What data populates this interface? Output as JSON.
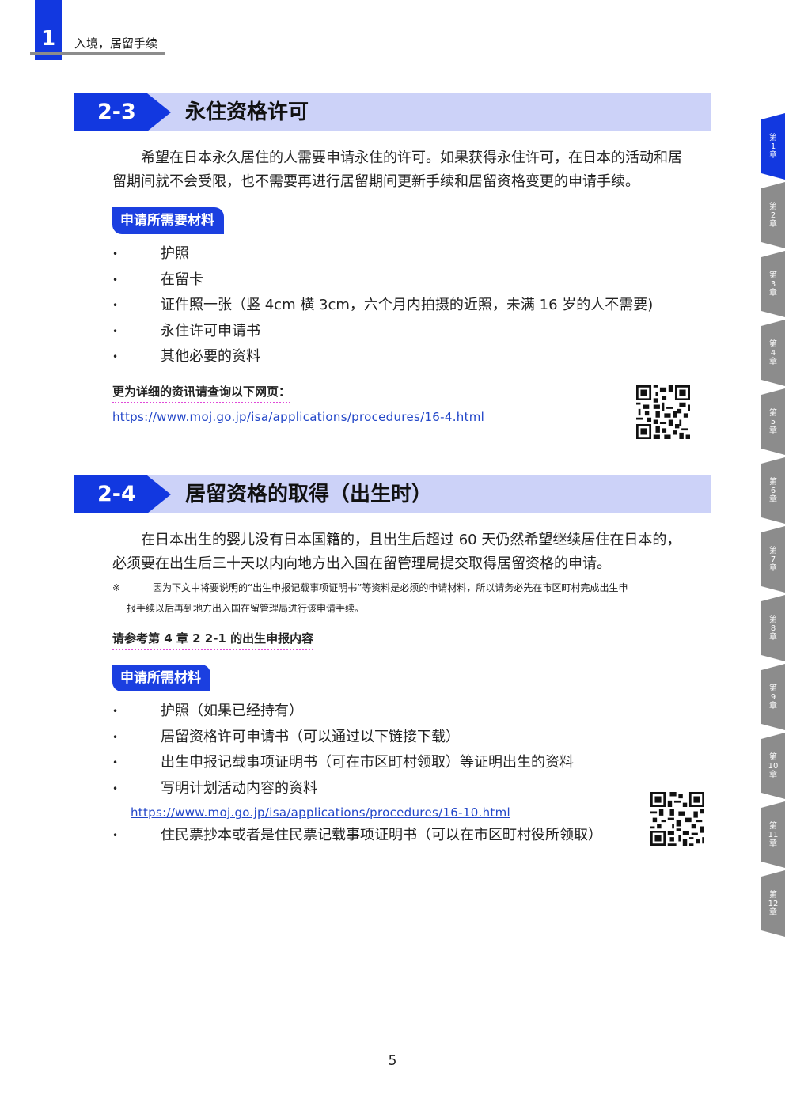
{
  "header": {
    "chapter_number": "1",
    "chapter_title": "入境，居留手续"
  },
  "section_2_3": {
    "number": "2-3",
    "title": "永住资格许可",
    "paragraph_line1": "希望在日本永久居住的人需要申请永住的许可。如果获得永住许可，在日本的活动和居",
    "paragraph_line2": "留期间就不会受限，也不需要再进行居留期间更新手续和居留资格变更的申请手续。",
    "materials_tag": "申请所需要材料",
    "materials": [
      "护照",
      "在留卡",
      "证件照一张（竖 4cm 横 3cm，六个月内拍摄的近照，未满 16 岁的人不需要)",
      "永住许可申请书",
      "其他必要的资料"
    ],
    "more_info_label": "更为详细的资讯请查询以下网页：",
    "link": "https://www.moj.go.jp/isa/applications/procedures/16-4.html"
  },
  "section_2_4": {
    "number": "2-4",
    "title": "居留资格的取得（出生时）",
    "paragraph_line1": "在日本出生的婴儿没有日本国籍的，且出生后超过 60 天仍然希望继续居住在日本的，",
    "paragraph_line2": "必须要在出生后三十天以内向地方出入国在留管理局提交取得居留资格的申请。",
    "note_mark": "※",
    "note_line1": "因为下文中将要说明的“出生申报记载事项证明书”等资料是必须的申请材料，所以请务必先在市区町村完成出生申",
    "note_line2": "报手续以后再到地方出入国在留管理局进行该申请手续。",
    "reference_label": "请参考第 4 章 2 2-1 的出生申报内容",
    "materials_tag": "申请所需材料",
    "materials": [
      "护照（如果已经持有）",
      "居留资格许可申请书（可以通过以下链接下载）",
      "出生申报记载事项证明书（可在市区町村领取）等证明出生的资料",
      "写明计划活动内容的资料"
    ],
    "link": "https://www.moj.go.jp/isa/applications/procedures/16-10.html",
    "last_material": "住民票抄本或者是住民票记载事项证明书（可以在市区町村役所领取）"
  },
  "side_tabs": [
    {
      "top": "第",
      "num": "1",
      "bottom": "章"
    },
    {
      "top": "第",
      "num": "2",
      "bottom": "章"
    },
    {
      "top": "第",
      "num": "3",
      "bottom": "章"
    },
    {
      "top": "第",
      "num": "4",
      "bottom": "章"
    },
    {
      "top": "第",
      "num": "5",
      "bottom": "章"
    },
    {
      "top": "第",
      "num": "6",
      "bottom": "章"
    },
    {
      "top": "第",
      "num": "7",
      "bottom": "章"
    },
    {
      "top": "第",
      "num": "8",
      "bottom": "章"
    },
    {
      "top": "第",
      "num": "9",
      "bottom": "章"
    },
    {
      "top": "第",
      "num": "10",
      "bottom": "章"
    },
    {
      "top": "第",
      "num": "11",
      "bottom": "章"
    },
    {
      "top": "第",
      "num": "12",
      "bottom": "章"
    }
  ],
  "page_number": "5",
  "colors": {
    "primary": "#1238e0",
    "banner_bg": "#ccd2f8",
    "link": "#2246c8",
    "tab_inactive": "#8c8c8c",
    "underline": "#e04ad8"
  }
}
